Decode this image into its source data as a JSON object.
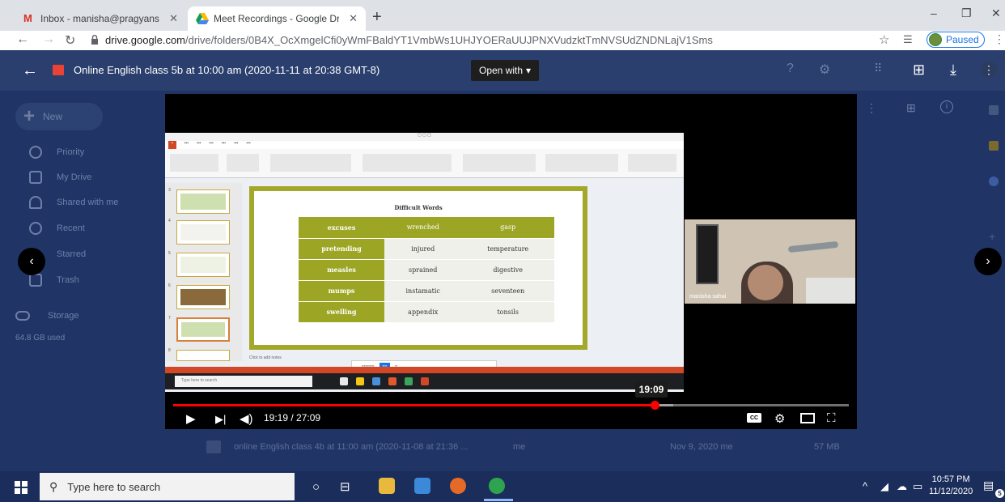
{
  "browser": {
    "tabs": [
      {
        "title": "Inbox - manisha@pragyanschool",
        "icon": "gmail-icon",
        "active": false
      },
      {
        "title": "Meet Recordings - Google Drive",
        "icon": "google-drive-icon",
        "active": true
      }
    ],
    "new_tab_label": "+",
    "window_controls": {
      "minimize": "–",
      "restore": "❐",
      "close": "✕"
    },
    "url_host": "drive.google.com",
    "url_path": "/drive/folders/0B4X_OcXmgelCfi0yWmFBaldYT1VmbWs1UHJYOERaUUJPNXVudzktTmNVSUdZNDNLajV1Sms",
    "profile_status": "Paused"
  },
  "viewer": {
    "file_title": "Online English class 5b at 10:00 am (2020-11-11 at 20:38 GMT-8)",
    "open_with_label": "Open with"
  },
  "drive_sidebar": {
    "new_label": "New",
    "items": [
      {
        "label": "Priority",
        "icon": "check-circle-icon"
      },
      {
        "label": "My Drive",
        "icon": "drive-icon"
      },
      {
        "label": "Shared with me",
        "icon": "people-icon"
      },
      {
        "label": "Recent",
        "icon": "clock-icon"
      },
      {
        "label": "Starred",
        "icon": "star-icon"
      },
      {
        "label": "Trash",
        "icon": "trash-icon"
      }
    ],
    "storage_label": "Storage",
    "storage_used": "64.8 GB used"
  },
  "background_file_row": {
    "name": "online English class 4b at 11:00 am (2020-11-08 at 21:36 ...",
    "owner_col": "me",
    "modified": "Nov 9, 2020 me",
    "size": "57 MB"
  },
  "slide": {
    "title": "Difficult Words",
    "rows": [
      [
        "excuses",
        "wrenched",
        "gasp"
      ],
      [
        "pretending",
        "injured",
        "temperature"
      ],
      [
        "measles",
        "sprained",
        "digestive"
      ],
      [
        "mumps",
        "instamatic",
        "seventeen"
      ],
      [
        "swelling",
        "appendix",
        "tonsils"
      ]
    ],
    "notes_placeholder": "Click to add notes",
    "inner_search_placeholder": "Type here to search"
  },
  "webcam": {
    "participant_name": "manisha sahai"
  },
  "player": {
    "hover_time": "19:09",
    "current_time": "19:19",
    "duration": "27:09",
    "time_display": "19:19 / 27:09",
    "progress_fraction": 0.712,
    "buffered_fraction": 0.74,
    "cc_label": "CC",
    "colors": {
      "played": "#ff0000",
      "background": "#000000"
    }
  },
  "taskbar": {
    "search_placeholder": "Type here to search",
    "time": "10:57 PM",
    "date": "11/12/2020",
    "notification_count": "5"
  }
}
